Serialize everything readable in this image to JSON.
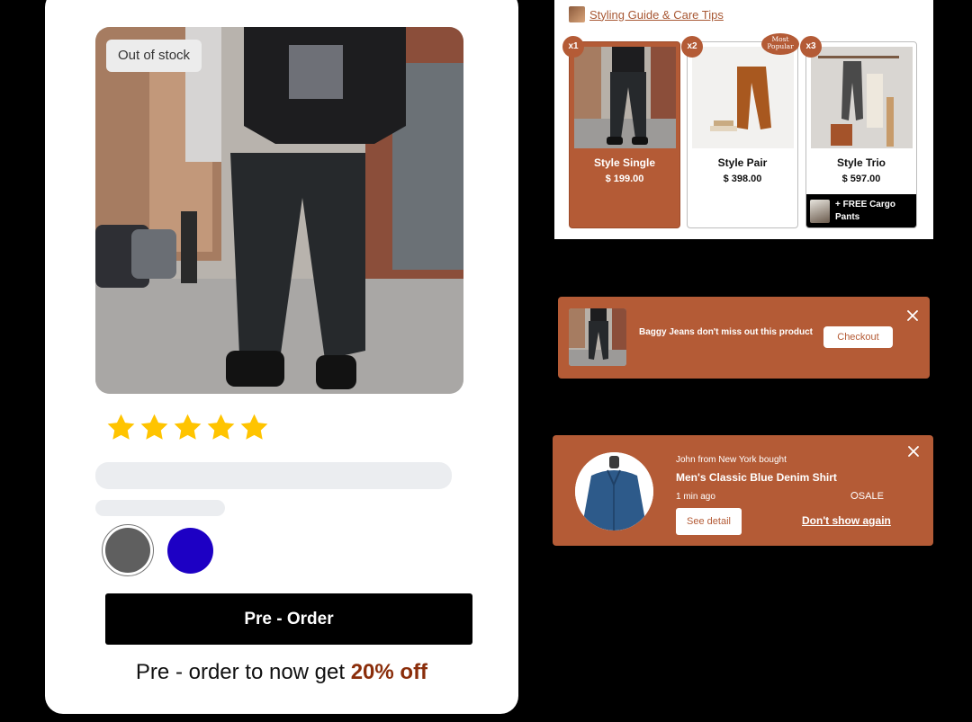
{
  "product_card": {
    "stock_badge": "Out of stock",
    "rating": 5,
    "swatch_colors": [
      "#5f5f5f",
      "#1d00c4"
    ],
    "preorder_button": "Pre - Order",
    "promo_prefix": "Pre - order to now get ",
    "promo_highlight": "20% off"
  },
  "bundles": {
    "guide_link": "Styling Guide & Care Tips",
    "items": [
      {
        "qty": "x1",
        "name": "Style Single",
        "price": "$ 199.00",
        "selected": true
      },
      {
        "qty": "x2",
        "name": "Style Pair",
        "price": "$ 398.00",
        "selected": false
      },
      {
        "qty": "x3",
        "name": "Style Trio",
        "price": "$ 597.00",
        "selected": false
      }
    ],
    "popular_tag": "Most Popular",
    "gift_line1": "+ FREE Cargo",
    "gift_line2": "Pants"
  },
  "checkout_toast": {
    "message": "Baggy Jeans don't miss out this product",
    "button": "Checkout"
  },
  "social_proof_toast": {
    "who": "John from New York bought",
    "product": "Men's Classic Blue Denim Shirt",
    "time_ago": "1 min ago",
    "sale_label": "⭘SALE",
    "detail_button": "See detail",
    "dismiss_link": "Don't show again"
  },
  "colors": {
    "accent": "#b45b36",
    "promo_highlight": "#8a2d0a",
    "star": "#ffc400"
  }
}
